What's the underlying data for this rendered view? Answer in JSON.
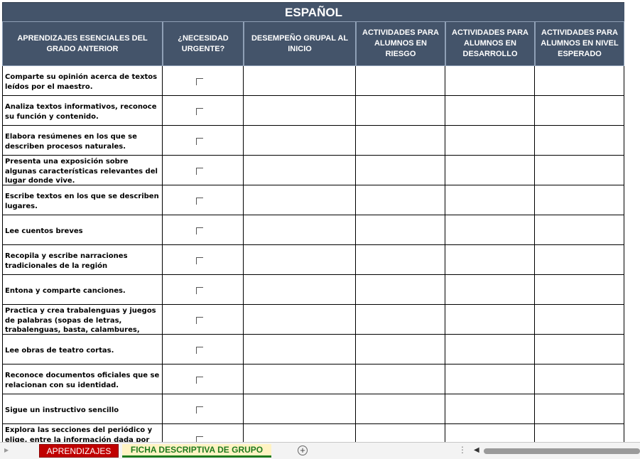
{
  "title": "ESPAÑOL",
  "headers": [
    "APRENDIZAJES ESENCIALES DEL GRADO ANTERIOR",
    "¿NECESIDAD URGENTE?",
    "DESEMPEÑO GRUPAL AL INICIO",
    "ACTIVIDADES PARA ALUMNOS EN RIESGO",
    "ACTIVIDADES PARA ALUMNOS EN DESARROLLO",
    "ACTIVIDADES PARA ALUMNOS EN NIVEL ESPERADO"
  ],
  "rows": [
    {
      "topic": "Comparte su opinión acerca de textos leídos por el maestro.",
      "urgent": false
    },
    {
      "topic": "Analiza textos informativos, reconoce su función y contenido.",
      "urgent": false
    },
    {
      "topic": "Elabora resúmenes en los que se describen procesos naturales.",
      "urgent": false
    },
    {
      "topic": "Presenta una exposición sobre algunas características relevantes del lugar donde vive.",
      "urgent": false
    },
    {
      "topic": "Escribe textos en los que se describen lugares.",
      "urgent": false
    },
    {
      "topic": "Lee cuentos breves",
      "urgent": false
    },
    {
      "topic": "Recopila y escribe narraciones tradicionales de la región",
      "urgent": false
    },
    {
      "topic": "Entona y comparte canciones.",
      "urgent": false
    },
    {
      "topic": "Practica y crea trabalenguas y juegos de palabras (sopas de letras, trabalenguas, basta, calambures,",
      "urgent": false
    },
    {
      "topic": "Lee obras de teatro cortas.",
      "urgent": false
    },
    {
      "topic": "Reconoce documentos oficiales que se relacionan con su identidad.",
      "urgent": false
    },
    {
      "topic": "Sigue un instructivo sencillo",
      "urgent": false
    },
    {
      "topic": "Explora las secciones del periódico y elige, entre la información dada por los",
      "urgent": false
    }
  ],
  "tabs": [
    {
      "label": "APRENDIZAJES",
      "color": "#c00000",
      "active": false
    },
    {
      "label": "FICHA DESCRIPTIVA DE GRUPO",
      "color": "#1e7a1e",
      "active": true
    }
  ],
  "icons": {
    "add_sheet": "plus-circle-icon",
    "scroll_left": "triangle-left-icon",
    "nav": "triangle-right-icon",
    "options": "vertical-dots-icon"
  },
  "colors": {
    "header_bg": "#44546a",
    "header_text": "#ffffff"
  }
}
